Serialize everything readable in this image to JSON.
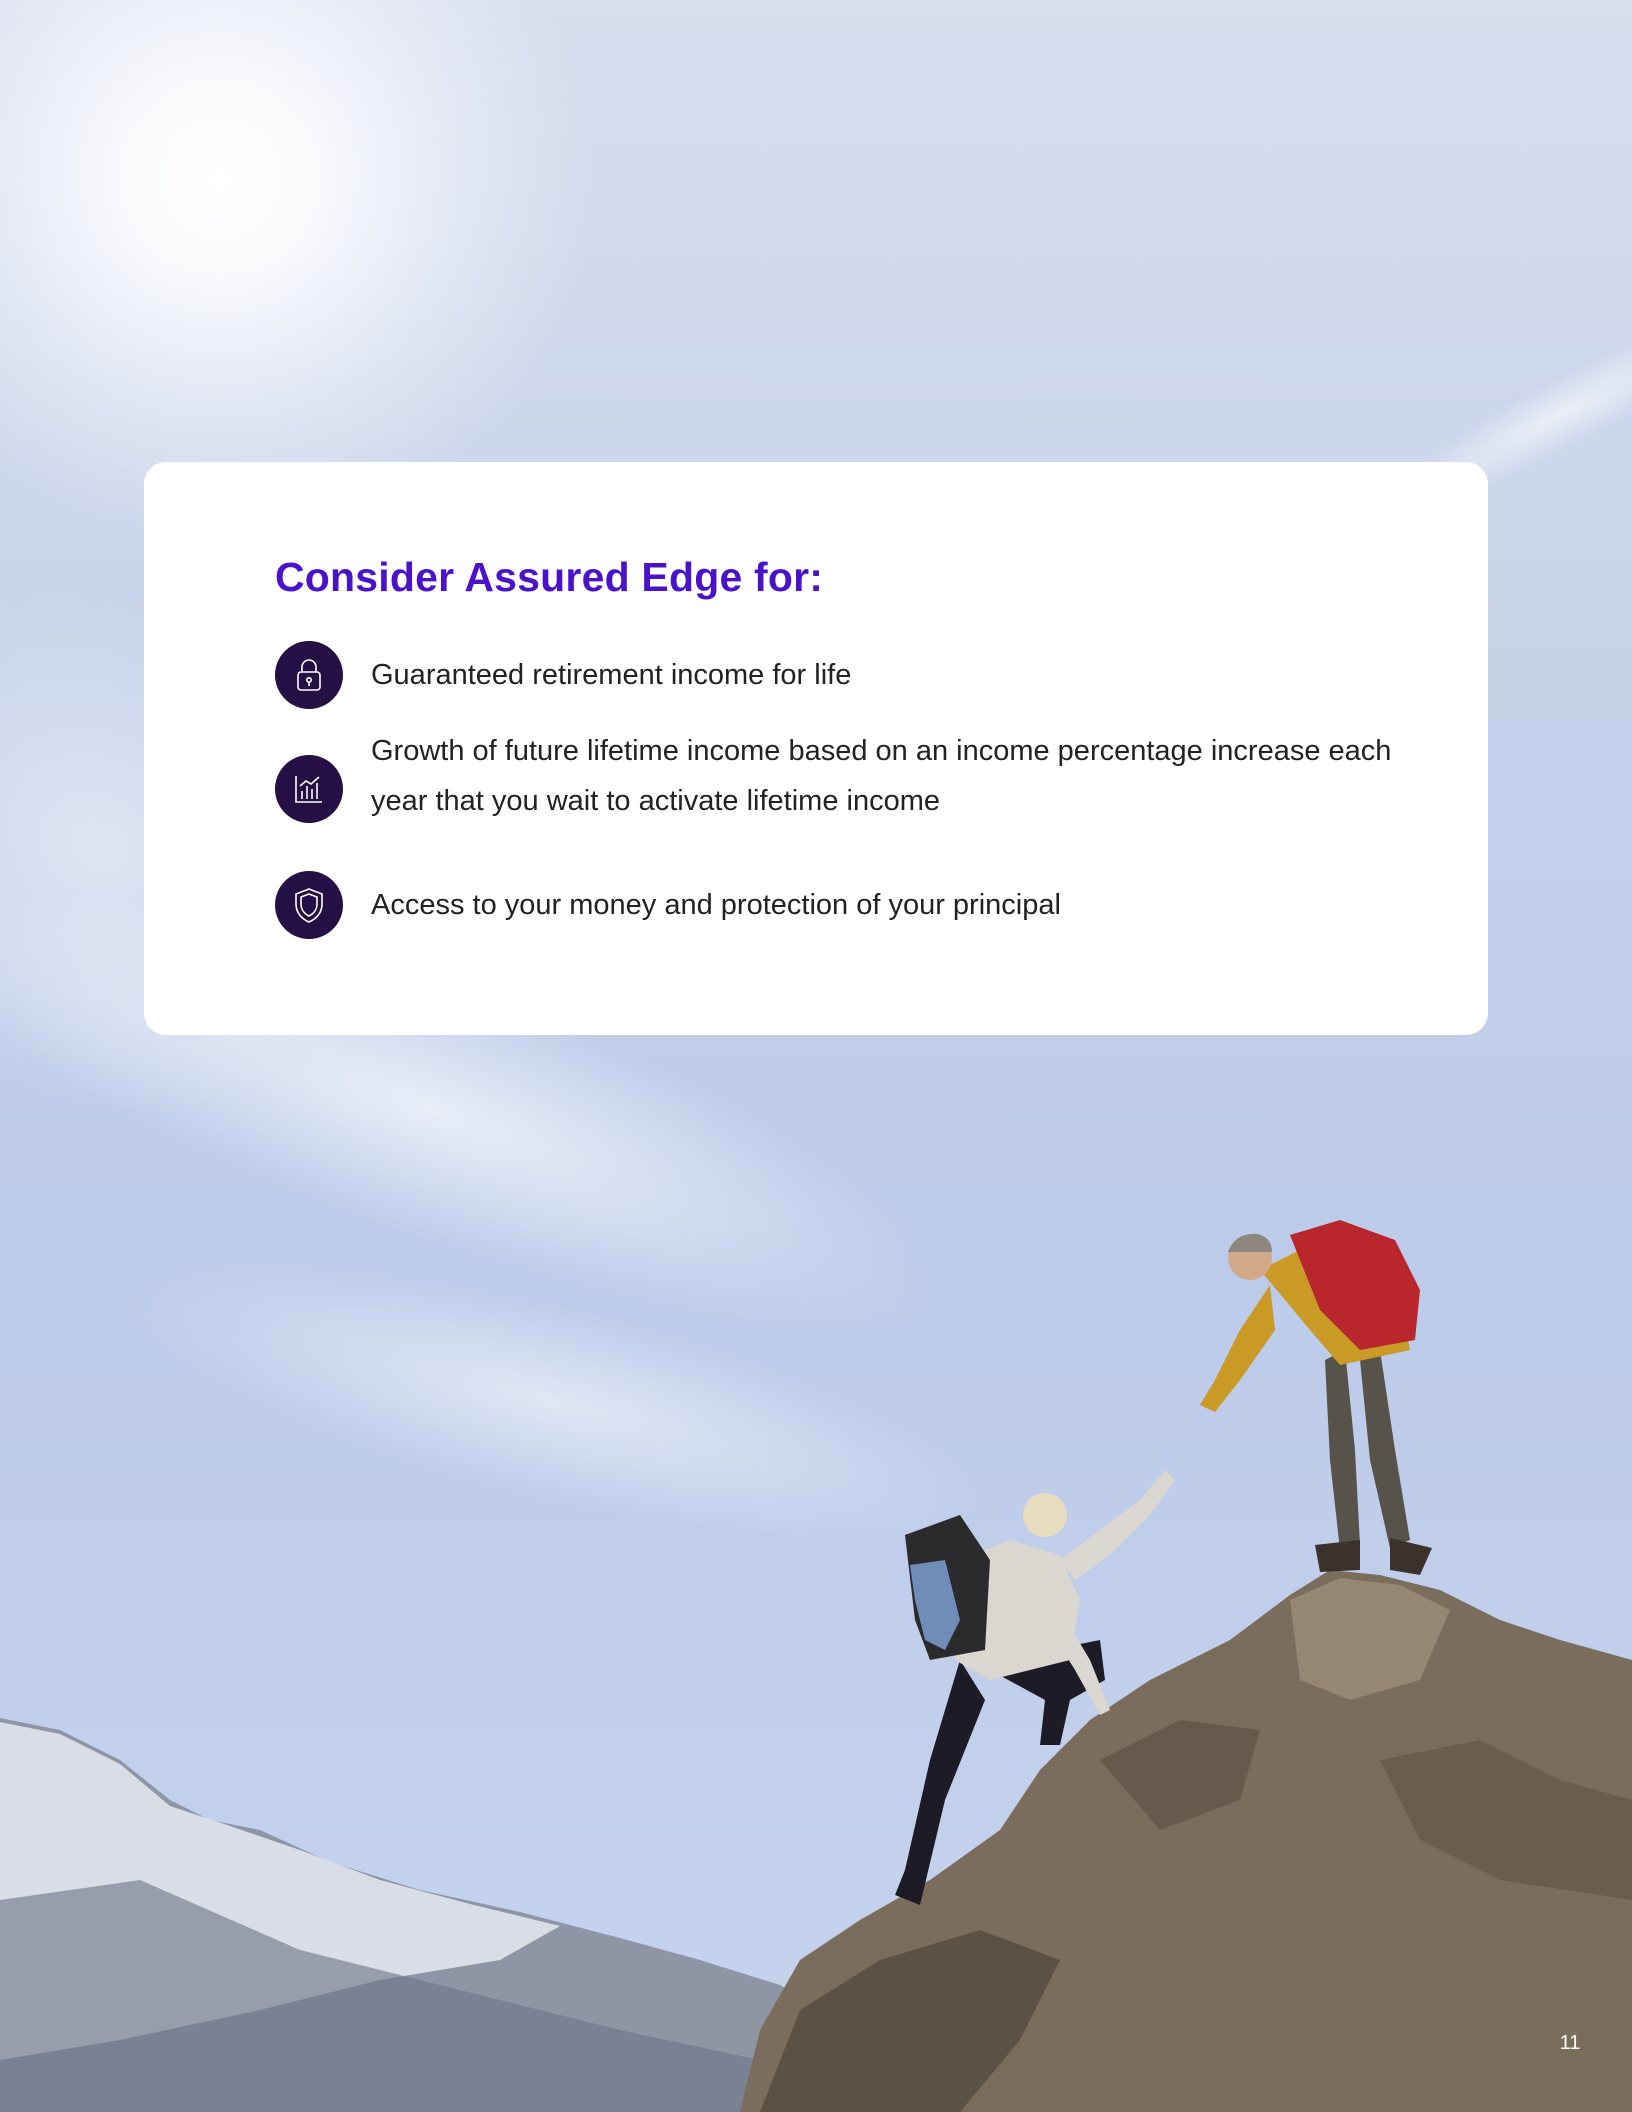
{
  "card": {
    "title": "Consider Assured Edge for:",
    "items": [
      {
        "icon": "lock-icon",
        "text": "Guaranteed retirement income for life"
      },
      {
        "icon": "bar-chart-icon",
        "text": "Growth of future lifetime income based on an income percentage increase each year that you wait to activate lifetime income"
      },
      {
        "icon": "shield-icon",
        "text": "Access to your money and protection of your principal"
      }
    ]
  },
  "page_number": "11",
  "colors": {
    "title": "#4a12c9",
    "icon_background": "#241044",
    "body_text": "#222222",
    "card_background": "#ffffff"
  }
}
